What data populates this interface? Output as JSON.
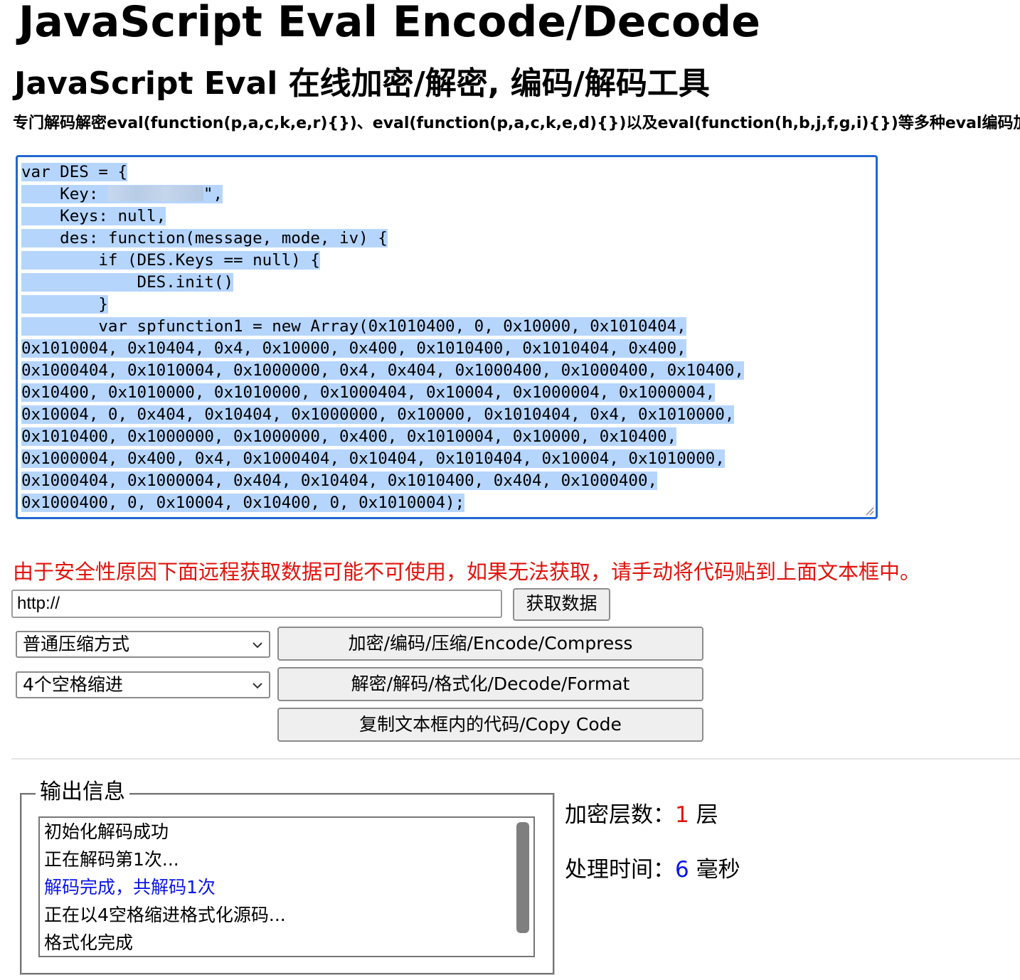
{
  "header": {
    "title": "JavaScript Eval Encode/Decode",
    "subtitle": "JavaScript Eval 在线加密/解密, 编码/解码工具",
    "description": "专门解码解密eval(function(p,a,c,k,e,r){})、eval(function(p,a,c,k,e,d){})以及eval(function(h,b,j,f,g,i){})等多种eval编码加密"
  },
  "editor": {
    "lines": [
      "var DES = {",
      "    Key: ",
      "    Keys: null,",
      "    des: function(message, mode, iv) {",
      "        if (DES.Keys == null) {",
      "            DES.init()",
      "        }",
      "        var spfunction1 = new Array(0x1010400, 0, 0x10000, 0x1010404,",
      "0x1010004, 0x10404, 0x4, 0x10000, 0x400, 0x1010400, 0x1010404, 0x400,",
      "0x1000404, 0x1010004, 0x1000000, 0x4, 0x404, 0x1000400, 0x1000400, 0x10400,",
      "0x10400, 0x1010000, 0x1010000, 0x1000404, 0x10004, 0x1000004, 0x1000004,",
      "0x10004, 0, 0x404, 0x10404, 0x1000000, 0x10000, 0x1010404, 0x4, 0x1010000,",
      "0x1010400, 0x1000000, 0x1000000, 0x400, 0x1010004, 0x10000, 0x10400,",
      "0x1000004, 0x400, 0x4, 0x1000404, 0x10404, 0x1010404, 0x10004, 0x1010000,",
      "0x1000404, 0x1000004, 0x404, 0x10404, 0x1010400, 0x404, 0x1000400,",
      "0x1000400, 0, 0x10004, 0x10400, 0, 0x1010004);"
    ],
    "key_suffix": "\","
  },
  "remote": {
    "warning": "由于安全性原因下面远程获取数据可能不可使用，如果无法获取，请手动将代码贴到上面文本框中。",
    "url_value": "http://",
    "fetch_label": "获取数据"
  },
  "controls": {
    "compress_select": "普通压缩方式",
    "indent_select": "4个空格缩进",
    "encode_label": "加密/编码/压缩/Encode/Compress",
    "decode_label": "解密/解码/格式化/Decode/Format",
    "copy_label": "复制文本框内的代码/Copy Code"
  },
  "output": {
    "legend": "输出信息",
    "messages": [
      {
        "text": "初始化解码成功",
        "color": "#000000"
      },
      {
        "text": "正在解码第1次...",
        "color": "#000000"
      },
      {
        "text": "解码完成，共解码1次",
        "color": "#0b17e8"
      },
      {
        "text": "正在以4空格缩进格式化源码...",
        "color": "#000000"
      },
      {
        "text": "格式化完成",
        "color": "#000000"
      }
    ]
  },
  "stats": {
    "layers_label": "加密层数：",
    "layers_value": "1",
    "layers_unit": " 层",
    "time_label": "处理时间：",
    "time_value": "6",
    "time_unit": " 毫秒"
  },
  "colors": {
    "accent_border": "#2168d1",
    "selection": "#b5d5fd",
    "warning": "#e0140c",
    "info": "#0b17e8"
  }
}
